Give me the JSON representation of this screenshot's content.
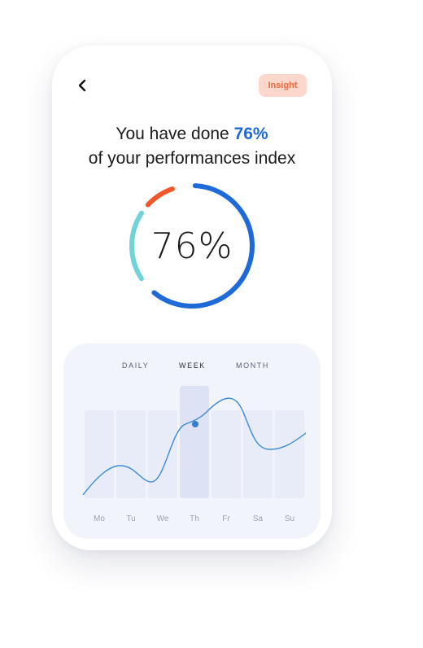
{
  "header": {
    "back_icon": "chevron-left-icon",
    "insight_label": "Insight"
  },
  "headline": {
    "line1_prefix": "You have done ",
    "line1_highlight": "76%",
    "line2": "of your performances index"
  },
  "progress": {
    "value_label": "76%",
    "value": 0.76,
    "colors": {
      "main": "#1e6ad8",
      "secondary": "#f0582c",
      "tertiary": "#6fd3d8"
    }
  },
  "chart": {
    "tabs": [
      "DAILY",
      "WEEK",
      "MONTH"
    ],
    "active_tab": "WEEK",
    "days": [
      "Mo",
      "Tu",
      "We",
      "Th",
      "Fr",
      "Sa",
      "Su"
    ],
    "highlight_day": "Th",
    "line_color": "#3a8ad8"
  }
}
